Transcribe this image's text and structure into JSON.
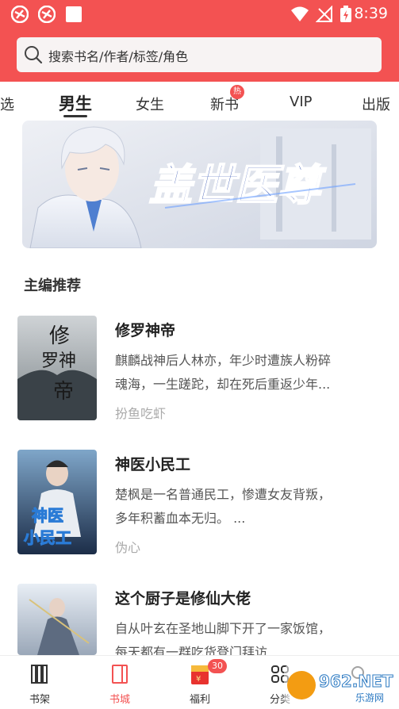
{
  "status_bar": {
    "time": "8:39"
  },
  "search": {
    "placeholder": "搜索书名/作者/标签/角色"
  },
  "tabs": [
    {
      "label": "选"
    },
    {
      "label": "男生"
    },
    {
      "label": "女生"
    },
    {
      "label": "新书",
      "badge": "热"
    },
    {
      "label": "VIP"
    },
    {
      "label": "出版"
    }
  ],
  "banner": {
    "title": "盖世医尊"
  },
  "section": {
    "title": "主编推荐"
  },
  "books": [
    {
      "title": "修罗神帝",
      "desc_line1": "麒麟战神后人林亦，年少时遭族人粉碎",
      "desc_line2": "魂海，一生蹉跎，却在死后重返少年...",
      "author": "扮鱼吃虾",
      "cover_text_a": "修",
      "cover_text_b": "罗神",
      "cover_text_c": "帝"
    },
    {
      "title": "神医小民工",
      "desc_line1": "楚枫是一名普通民工，惨遭女友背叛，",
      "desc_line2": "多年积蓄血本无归。 ...",
      "author": "伪心",
      "cover_text_a": "神医",
      "cover_text_b": "小民工"
    },
    {
      "title": "这个厨子是修仙大佬",
      "desc_line1": "自从叶玄在圣地山脚下开了一家饭馆，",
      "desc_line2": "每天都有一群吃货登门拜访"
    }
  ],
  "bottom_nav": [
    {
      "label": "书架",
      "icon": "bookshelf-icon"
    },
    {
      "label": "书城",
      "icon": "bookstore-icon",
      "active": true
    },
    {
      "label": "福利",
      "icon": "gift-icon",
      "badge": "30"
    },
    {
      "label": "分类",
      "icon": "category-icon"
    },
    {
      "label": "",
      "icon": "search-icon"
    }
  ],
  "watermark": {
    "text_main": "962.NET",
    "text_sub": "乐游网"
  },
  "colors": {
    "brand_red": "#f35252",
    "banner_blue": "#1d3fa8"
  }
}
